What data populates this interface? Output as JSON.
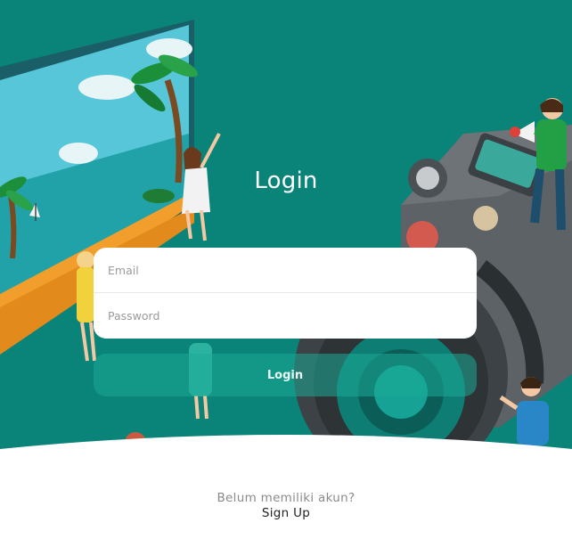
{
  "colors": {
    "background": "#0a8379",
    "login_button": "#1caa96",
    "card": "#ffffff"
  },
  "header": {
    "title": "Login"
  },
  "form": {
    "email_placeholder": "Email",
    "password_placeholder": "Password",
    "submit_label": "Login"
  },
  "footer": {
    "question": "Belum memiliki akun?",
    "signup_label": "Sign Up"
  },
  "illustration": {
    "icons": [
      "beach-billboard-icon",
      "palm-tree-icon",
      "camera-icon",
      "megaphone-man-icon",
      "woman-sitting-icon",
      "people-icon"
    ]
  }
}
